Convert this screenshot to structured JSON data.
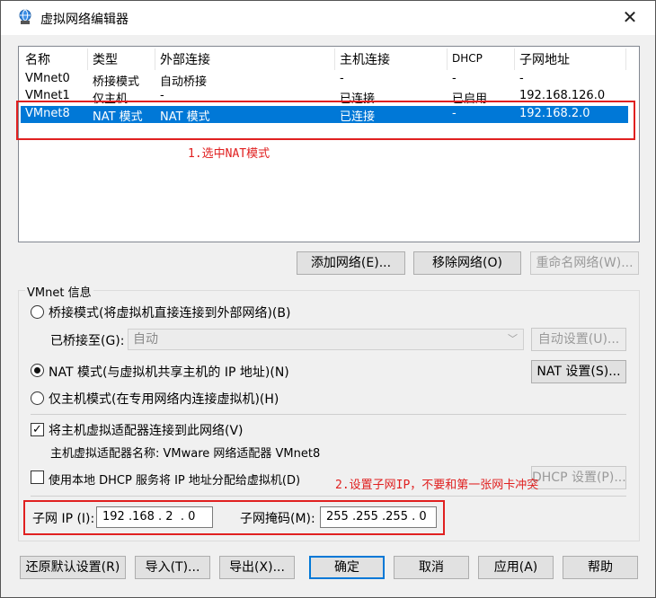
{
  "window": {
    "title": "虚拟网络编辑器",
    "close_symbol": "✕"
  },
  "table": {
    "columns": [
      "名称",
      "类型",
      "外部连接",
      "主机连接",
      "DHCP",
      "子网地址"
    ],
    "rows": [
      {
        "name": "VMnet0",
        "type": "桥接模式",
        "external": "自动桥接",
        "host": "-",
        "dhcp": "-",
        "subnet": "-"
      },
      {
        "name": "VMnet1",
        "type": "仅主机...",
        "external": "-",
        "host": "已连接",
        "dhcp": "已启用",
        "subnet": "192.168.126.0"
      },
      {
        "name": "VMnet8",
        "type": "NAT 模式",
        "external": "NAT 模式",
        "host": "已连接",
        "dhcp": "-",
        "subnet": "192.168.2.0"
      }
    ]
  },
  "annotations": {
    "note1": "1.选中NAT模式",
    "note2": "2.设置子网IP，不要和第一张网卡冲突"
  },
  "list_buttons": {
    "add": "添加网络(E)...",
    "remove": "移除网络(O)",
    "rename": "重命名网络(W)..."
  },
  "vmnet_info": {
    "title": "VMnet 信息",
    "bridge_mode": "桥接模式(将虚拟机直接连接到外部网络)(B)",
    "bridged_to_label": "已桥接至(G):",
    "bridged_to_value": "自动",
    "auto_settings": "自动设置(U)...",
    "nat_mode": "NAT 模式(与虚拟机共享主机的 IP 地址)(N)",
    "nat_settings": "NAT 设置(S)...",
    "host_only": "仅主机模式(在专用网络内连接虚拟机)(H)",
    "connect_adapter": "将主机虚拟适配器连接到此网络(V)",
    "adapter_name": "主机虚拟适配器名称: VMware 网络适配器 VMnet8",
    "use_dhcp": "使用本地 DHCP 服务将 IP 地址分配给虚拟机(D)",
    "dhcp_settings": "DHCP 设置(P)...",
    "subnet_ip_label": "子网 IP (I):",
    "subnet_ip": "192 .168 . 2  . 0",
    "subnet_mask_label": "子网掩码(M):",
    "subnet_mask": "255 .255 .255 . 0"
  },
  "footer_buttons": {
    "restore": "还原默认设置(R)",
    "import": "导入(T)...",
    "export": "导出(X)...",
    "ok": "确定",
    "cancel": "取消",
    "apply": "应用(A)",
    "help": "帮助"
  },
  "colors": {
    "selection": "#0078d7",
    "annotation": "#e02020"
  }
}
